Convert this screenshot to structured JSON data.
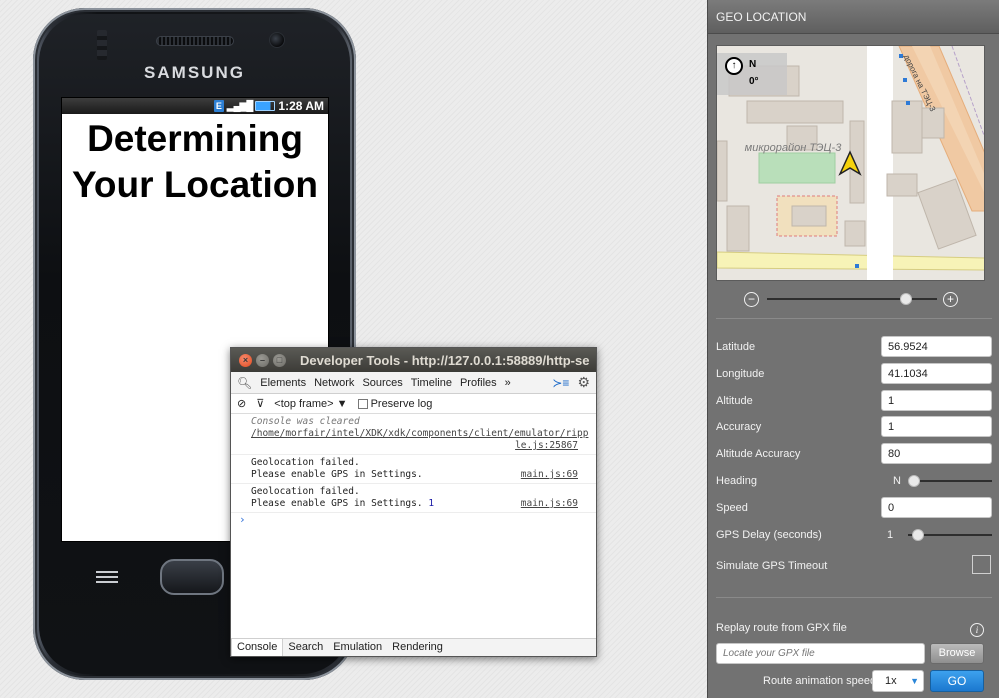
{
  "phone": {
    "brand": "SAMSUNG",
    "status_time": "1:28 AM",
    "status_network": "E",
    "headline": "Determining Your Location"
  },
  "devtools": {
    "title": "Developer Tools - http://127.0.0.1:58889/http-se",
    "tabs": [
      "Elements",
      "Network",
      "Sources",
      "Timeline",
      "Profiles",
      "»"
    ],
    "frame_select": "<top frame>",
    "preserve_log_label": "Preserve log",
    "console_cleared": "Console was cleared",
    "cleared_source": "/home/morfair/intel/XDK/xdk/components/client/emulator/ripple.js:25867",
    "cleared_source_line1": "/home/morfair/intel/XDK/xdk/components/client/emulator/ripp",
    "cleared_source_line2": "le.js:25867",
    "log_entries": [
      {
        "line1": "Geolocation failed.",
        "line2": "Please enable GPS in Settings.",
        "count": "",
        "source": "main.js:69"
      },
      {
        "line1": "Geolocation failed.",
        "line2": "Please enable GPS in Settings.",
        "count": "1",
        "source": "main.js:69"
      }
    ],
    "prompt": "›",
    "bottom_tabs": [
      "Console",
      "Search",
      "Emulation",
      "Rendering"
    ]
  },
  "geo": {
    "header": "GEO LOCATION",
    "compass_n": "N",
    "compass_deg": "0°",
    "map_district": "микрорайон ТЭЦ-3",
    "map_road": "дорога на ТЭЦ-3",
    "zoom_level": 0.82,
    "fields": {
      "latitude_label": "Latitude",
      "latitude": "56.9524",
      "longitude_label": "Longitude",
      "longitude": "41.1034",
      "altitude_label": "Altitude",
      "altitude": "1",
      "accuracy_label": "Accuracy",
      "accuracy": "1",
      "alt_accuracy_label": "Altitude Accuracy",
      "alt_accuracy": "80",
      "heading_label": "Heading",
      "heading_value": "N",
      "speed_label": "Speed",
      "speed": "0",
      "gps_delay_label": "GPS Delay (seconds)",
      "gps_delay_value": "1",
      "timeout_label": "Simulate GPS Timeout"
    },
    "gpx": {
      "label": "Replay route from GPX file",
      "placeholder": "Locate your GPX file",
      "browse": "Browse",
      "speed_label": "Route animation speed",
      "speed_value": "1x",
      "go": "GO"
    }
  }
}
